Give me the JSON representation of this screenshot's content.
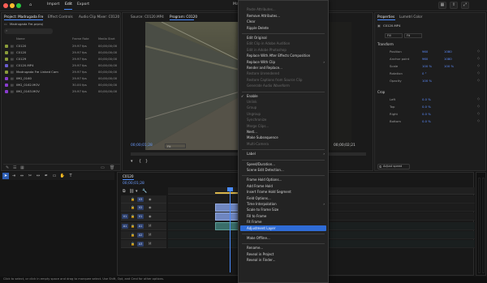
{
  "menu": {
    "import": "Import",
    "edit": "Edit",
    "export": "Export",
    "title": "Madrugada"
  },
  "project_panel": {
    "tabs": [
      "Project: Madrugada Fre",
      "Effect Controls",
      "Audio Clip Mixer: C0120"
    ],
    "bin_name": "Madrugada Fre.prproj",
    "columns": [
      "Name",
      "Frame Rate",
      "Media Start"
    ],
    "items": [
      {
        "name": "C0120",
        "fps": "29.97 fps",
        "start": "00;00;00;00",
        "color": "#8a9c3a"
      },
      {
        "name": "C0120",
        "fps": "29.97 fps",
        "start": "00;00;00;00",
        "color": "#8a9c3a"
      },
      {
        "name": "C0129",
        "fps": "29.97 fps",
        "start": "00;00;00;00",
        "color": "#8a9c3a"
      },
      {
        "name": "C0120.MP4",
        "fps": "29.97 fps",
        "start": "00;00;00;00",
        "color": "#6a5ccf"
      },
      {
        "name": "Madrugada Fre Linked Cam",
        "fps": "29.97 fps",
        "start": "00;00;00;00",
        "color": "#8a9c3a"
      },
      {
        "name": "IMG_0160",
        "fps": "29.97 fps",
        "start": "00;00;00;00",
        "color": "#8a3ccf"
      },
      {
        "name": "IMG_0162.MOV",
        "fps": "30.00 fps",
        "start": "00;00;00;00",
        "color": "#8a3ccf"
      },
      {
        "name": "IMG_0163.MOV",
        "fps": "29.97 fps",
        "start": "00;00;00;00",
        "color": "#8a3ccf"
      }
    ]
  },
  "program": {
    "tabs": [
      "Source: C0120.MP4",
      "Program: C0120"
    ],
    "timecode_left": "00;00;01;28",
    "fit": "Fit",
    "timecode_right": "00;00;02;21"
  },
  "properties": {
    "tabs": [
      "Properties",
      "Lumetri Color"
    ],
    "clip_name": "C0120.MP4",
    "fill_label": "Fill",
    "fit_label": "Fit",
    "sections": [
      {
        "title": "Transform",
        "rows": [
          {
            "label": "Position",
            "v1": "960",
            "v2": "1080"
          },
          {
            "label": "Anchor point",
            "v1": "960",
            "v2": "1080"
          },
          {
            "label": "Scale",
            "v1": "100 %",
            "v2": "100 %"
          },
          {
            "label": "Rotation",
            "v1": "0 °",
            "v2": ""
          },
          {
            "label": "Opacity",
            "v1": "100 %",
            "v2": ""
          }
        ]
      },
      {
        "title": "Crop",
        "rows": [
          {
            "label": "Left",
            "v1": "0.0 %",
            "v2": ""
          },
          {
            "label": "Top",
            "v1": "0.0 %",
            "v2": ""
          },
          {
            "label": "Right",
            "v1": "0.0 %",
            "v2": ""
          },
          {
            "label": "Bottom",
            "v1": "0.0 %",
            "v2": ""
          }
        ]
      }
    ],
    "adjust_speed": "Adjust speed"
  },
  "timeline": {
    "tab": "C0120",
    "timecode": "00;00;01;28",
    "tracks": [
      "V3",
      "V2",
      "V1",
      "A1",
      "A2",
      "A3"
    ],
    "source_tag": "V1"
  },
  "context_menu": {
    "items": [
      {
        "label": "",
        "type": "dis"
      },
      {
        "label": "Paste Attributes...",
        "type": "dis"
      },
      {
        "label": "Remove Attributes...",
        "type": "norm"
      },
      {
        "label": "Clear",
        "type": "norm"
      },
      {
        "label": "Ripple Delete",
        "type": "norm"
      },
      {
        "type": "sep"
      },
      {
        "label": "Edit Original",
        "type": "norm"
      },
      {
        "label": "Edit Clip in Adobe Audition",
        "type": "dis"
      },
      {
        "label": "Edit in Adobe Photoshop",
        "type": "dis"
      },
      {
        "label": "Replace With After Effects Composition",
        "type": "norm"
      },
      {
        "label": "Replace With Clip",
        "type": "norm",
        "arrow": true
      },
      {
        "label": "Render and Replace...",
        "type": "norm"
      },
      {
        "label": "Restore Unrendered",
        "type": "dis"
      },
      {
        "label": "Restore Captions from Source Clip",
        "type": "dis"
      },
      {
        "label": "Generate Audio Waveform",
        "type": "dis"
      },
      {
        "type": "sep"
      },
      {
        "label": "Enable",
        "type": "norm",
        "check": true
      },
      {
        "label": "Unlink",
        "type": "dis"
      },
      {
        "label": "Group",
        "type": "dis"
      },
      {
        "label": "Ungroup",
        "type": "dis"
      },
      {
        "label": "Synchronize",
        "type": "dis"
      },
      {
        "label": "Merge Clips...",
        "type": "dis"
      },
      {
        "label": "Nest...",
        "type": "norm"
      },
      {
        "label": "Make Subsequence",
        "type": "norm"
      },
      {
        "label": "Multi-Camera",
        "type": "dis"
      },
      {
        "type": "sep"
      },
      {
        "label": "Label",
        "type": "norm",
        "arrow": true
      },
      {
        "type": "sep"
      },
      {
        "label": "Speed/Duration...",
        "type": "norm"
      },
      {
        "label": "Scene Edit Detection...",
        "type": "norm"
      },
      {
        "type": "sep"
      },
      {
        "label": "Frame Hold Options...",
        "type": "norm"
      },
      {
        "label": "Add Frame Hold",
        "type": "norm"
      },
      {
        "label": "Insert Frame Hold Segment",
        "type": "norm"
      },
      {
        "label": "Field Options...",
        "type": "norm"
      },
      {
        "label": "Time Interpolation",
        "type": "norm",
        "arrow": true
      },
      {
        "label": "Scale to Frame Size",
        "type": "norm"
      },
      {
        "label": "Fill to Frame",
        "type": "norm"
      },
      {
        "label": "Fit Frame",
        "type": "norm"
      },
      {
        "label": "Adjustment Layer",
        "type": "hl"
      },
      {
        "type": "sep"
      },
      {
        "label": "Make Offline...",
        "type": "norm"
      },
      {
        "type": "sep"
      },
      {
        "label": "Rename...",
        "type": "norm"
      },
      {
        "label": "Reveal in Project",
        "type": "norm"
      },
      {
        "label": "Reveal in Finder...",
        "type": "norm"
      }
    ]
  },
  "status_bar": "Click to select, or click in empty space and drag to marquee select. Use Shift, Opt, and Cmd for other options."
}
